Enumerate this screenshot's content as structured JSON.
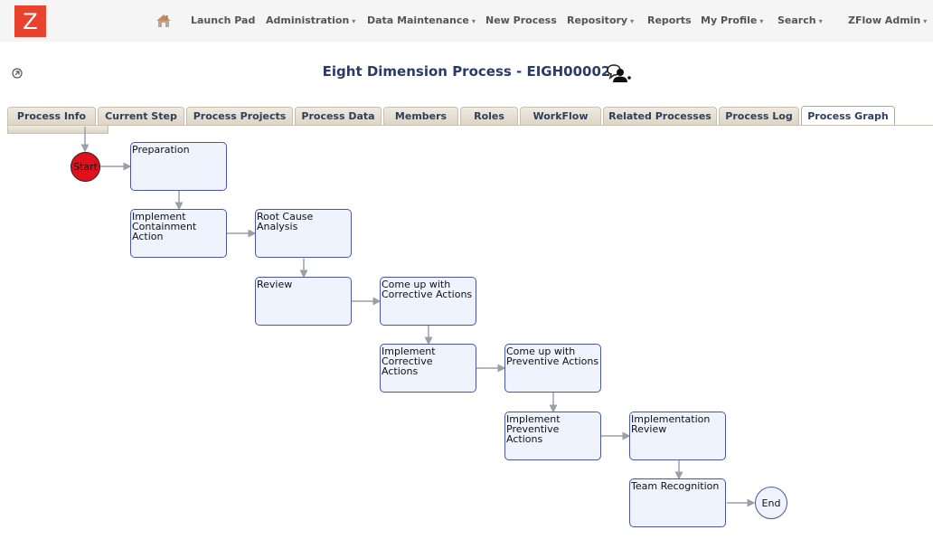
{
  "app": {
    "logo": "Z"
  },
  "nav": {
    "home_icon": "home-icon",
    "items": [
      {
        "label": "Launch Pad",
        "dropdown": false
      },
      {
        "label": "Administration",
        "dropdown": true
      },
      {
        "label": "Data Maintenance",
        "dropdown": true
      },
      {
        "label": "New Process",
        "dropdown": false
      },
      {
        "label": "Repository",
        "dropdown": true
      },
      {
        "label": "Reports",
        "dropdown": false
      },
      {
        "label": "My Profile",
        "dropdown": true
      },
      {
        "label": "Search",
        "dropdown": true
      },
      {
        "label": "ZFlow Admin",
        "dropdown": true
      }
    ],
    "caret": "▾"
  },
  "header": {
    "title": "Eight Dimension Process - EIGH00002",
    "collapse_icon": "collapse-icon",
    "members_icon": "members-icon"
  },
  "tabs": [
    {
      "label": "Process Info",
      "active": false
    },
    {
      "label": "Current Step",
      "active": false
    },
    {
      "label": "Process Projects",
      "active": false
    },
    {
      "label": "Process Data",
      "active": false
    },
    {
      "label": "Members",
      "active": false
    },
    {
      "label": "Roles",
      "active": false
    },
    {
      "label": "WorkFlow",
      "active": false
    },
    {
      "label": "Related Processes",
      "active": false
    },
    {
      "label": "Process Log",
      "active": false
    },
    {
      "label": "Process Graph",
      "active": true
    }
  ],
  "graph": {
    "start": "Start",
    "end": "End",
    "steps": [
      "Preparation",
      "Implement Containment\nAction",
      "Root Cause Analysis",
      "Review",
      "Come up with\nCorrective Actions",
      "Implement Corrective\nActions",
      "Come up with\nPreventive Actions",
      "Implement Preventive\nActions",
      "Implementation\nReview",
      "Team Recognition"
    ]
  },
  "colors": {
    "logo": "#e8432e",
    "title": "#2a3a6a",
    "node_fill": "#eef3fd",
    "node_border": "#4a55a8",
    "start_fill": "#e0101c",
    "edge": "#9aa0aa"
  }
}
